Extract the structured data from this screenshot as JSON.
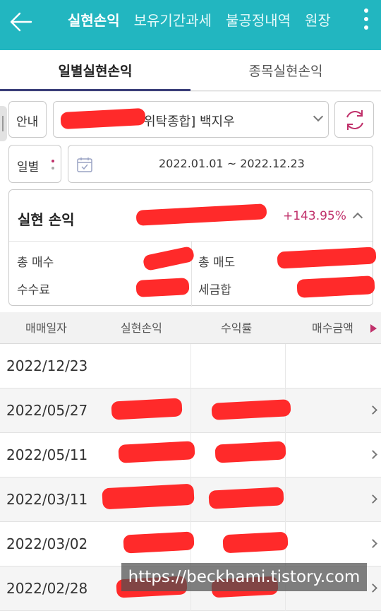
{
  "header": {
    "tabs": [
      "실현손익",
      "보유기간과세",
      "불공정내역",
      "원장"
    ]
  },
  "subtabs": [
    "일별실현손익",
    "종목실현손익"
  ],
  "filters": {
    "guide_label": "안내",
    "account_text": "위탁종합] 백지우",
    "period_label": "일별",
    "date_range": "2022.01.01 ~ 2022.12.23"
  },
  "summary": {
    "title": "실현 손익",
    "profit_pct": "+143.95%",
    "total_buy_label": "총 매수",
    "total_sell_label": "총 매도",
    "fee_label": "수수료",
    "tax_label": "세금합"
  },
  "table": {
    "headers": [
      "매매일자",
      "실현손익",
      "수익률",
      "매수금액"
    ],
    "rows": [
      {
        "date": "2022/12/23"
      },
      {
        "date": "2022/05/27"
      },
      {
        "date": "2022/05/11"
      },
      {
        "date": "2022/03/11"
      },
      {
        "date": "2022/03/02"
      },
      {
        "date": "2022/02/28"
      }
    ]
  },
  "watermark": "https://beckhami.tistory.com",
  "colors": {
    "header_bg": "#22b6c0",
    "accent": "#c0306a",
    "tab_underline": "#3b3f7a",
    "redaction": "#ff2a2a"
  }
}
